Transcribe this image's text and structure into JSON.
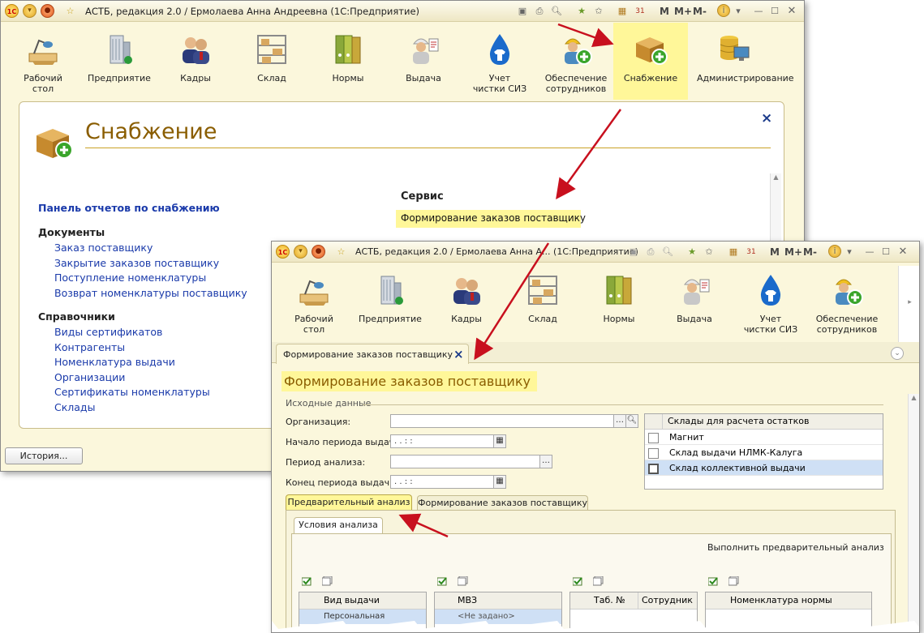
{
  "back_window": {
    "title": "АСТБ, редакция 2.0 / Ермолаева Анна Андреевна  (1С:Предприятие)",
    "toolbar_m": [
      "M",
      "M+",
      "M-"
    ],
    "sections": [
      {
        "label": "Рабочий стол",
        "icon": "desk-lamp-icon"
      },
      {
        "label": "Предприятие",
        "icon": "building-icon"
      },
      {
        "label": "Кадры",
        "icon": "people-icon"
      },
      {
        "label": "Склад",
        "icon": "shelves-icon"
      },
      {
        "label": "Нормы",
        "icon": "binders-icon"
      },
      {
        "label": "Выдача",
        "icon": "worker-icon"
      },
      {
        "label": "Учет чистки СИЗ",
        "icon": "water-drop-shirt-icon"
      },
      {
        "label": "Обеспечение сотрудников",
        "icon": "worker-plus-icon"
      },
      {
        "label": "Снабжение",
        "icon": "box-plus-icon"
      },
      {
        "label": "Администрирование",
        "icon": "database-computer-icon"
      }
    ],
    "panel": {
      "title": "Снабжение",
      "close": "×",
      "reports_link": "Панель отчетов по снабжению",
      "documents_header": "Документы",
      "documents": [
        "Заказ поставщику",
        "Закрытие заказов поставщику",
        "Поступление номенклатуры",
        "Возврат номенклатуры поставщику"
      ],
      "refs_header": "Справочники",
      "refs": [
        "Виды сертификатов",
        "Контрагенты",
        "Номенклатура выдачи",
        "Организации",
        "Сертификаты номенклатуры",
        "Склады"
      ],
      "service_header": "Сервис",
      "service_link": "Формирование заказов поставщику"
    },
    "history_button": "История..."
  },
  "front_window": {
    "title": "АСТБ, редакция 2.0 / Ермолаева Анна А... (1С:Предприятие)",
    "toolbar_m": [
      "M",
      "M+",
      "M-"
    ],
    "sections": [
      {
        "label": "Рабочий стол",
        "icon": "desk-lamp-icon"
      },
      {
        "label": "Предприятие",
        "icon": "building-icon"
      },
      {
        "label": "Кадры",
        "icon": "people-icon"
      },
      {
        "label": "Склад",
        "icon": "shelves-icon"
      },
      {
        "label": "Нормы",
        "icon": "binders-icon"
      },
      {
        "label": "Выдача",
        "icon": "worker-icon"
      },
      {
        "label": "Учет чистки СИЗ",
        "icon": "water-drop-shirt-icon"
      },
      {
        "label": "Обеспечение сотрудников",
        "icon": "worker-plus-icon"
      }
    ],
    "form_tab": "Формирование заказов поставщику",
    "form_tab_close": "×",
    "form_title": "Формирование заказов поставщику",
    "source_data_group": "Исходные данные",
    "fields": {
      "org_label": "Организация:",
      "org_value": "",
      "period_start_label": "Начало периода выдачи:",
      "period_start_value": " .  .     :  :",
      "analysis_period_label": "Период анализа:",
      "analysis_period_value": "",
      "period_end_label": "Конец периода выдачи:",
      "period_end_value": " .  .     :  :"
    },
    "warehouses": {
      "header": "Склады для расчета остатков",
      "rows": [
        {
          "name": "Магнит",
          "checked": false
        },
        {
          "name": "Склад выдачи НЛМК-Калуга",
          "checked": false
        },
        {
          "name": "Склад коллективной выдачи",
          "checked": false
        }
      ]
    },
    "tabs": [
      "Предварительный анализ",
      "Формирование заказов поставщику"
    ],
    "subtab": "Условия анализа",
    "run_analysis": "Выполнить предварительный анализ",
    "table_columns": [
      "Вид выдачи",
      "МВЗ",
      "Таб. №",
      "Сотрудник",
      "Номенклатура нормы"
    ],
    "row_partial": [
      "Персональная",
      "<Не задано>"
    ]
  }
}
